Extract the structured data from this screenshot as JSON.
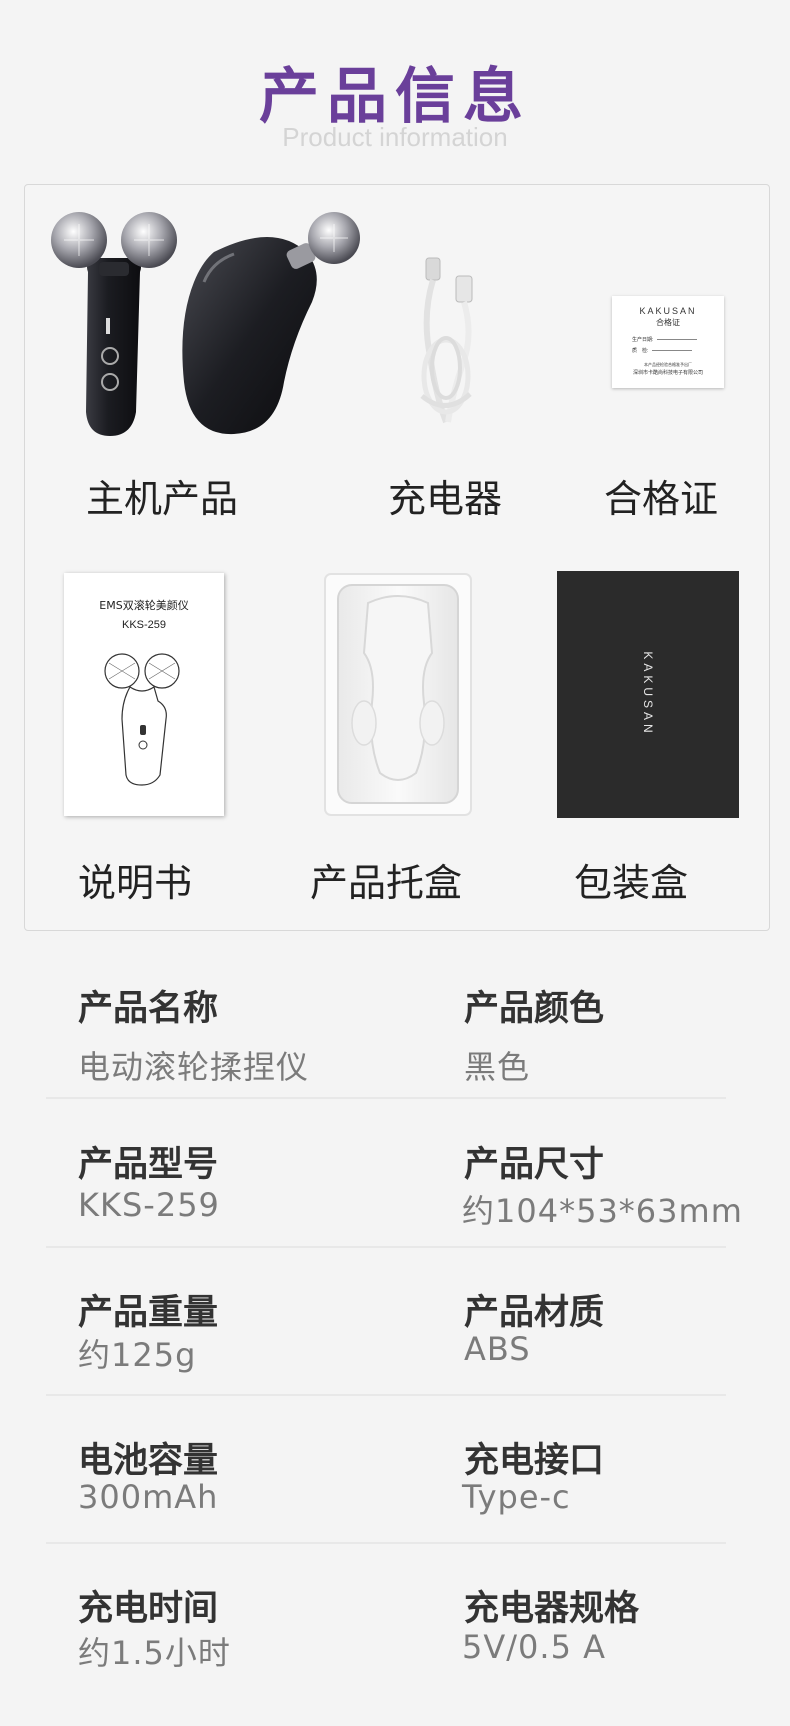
{
  "header": {
    "title": "产品信息",
    "subtitle": "Product information"
  },
  "package": {
    "items": [
      {
        "label": "主机产品"
      },
      {
        "label": "充电器"
      },
      {
        "label": "合格证"
      },
      {
        "label": "说明书"
      },
      {
        "label": "产品托盒"
      },
      {
        "label": "包装盒"
      }
    ],
    "certificate": {
      "brand": "KAKUSAN",
      "title": "合格证",
      "date_label": "生产日期:",
      "inspector_label": "质　检:",
      "footer_line1": "本产品经检验合格准予出厂",
      "footer_line2": "深圳市卡酷尚科技电子有限公司"
    },
    "manual": {
      "title": "EMS双滚轮美颜仪",
      "model": "KKS-259"
    },
    "box": {
      "brand": "KAKUSAN"
    }
  },
  "specs": [
    {
      "left": {
        "name": "产品名称",
        "value": "电动滚轮揉捏仪"
      },
      "right": {
        "name": "产品颜色",
        "value": "黑色"
      }
    },
    {
      "left": {
        "name": "产品型号",
        "value": "KKS-259"
      },
      "right": {
        "name": "产品尺寸",
        "value": "约104*53*63mm"
      }
    },
    {
      "left": {
        "name": "产品重量",
        "value": "约125g"
      },
      "right": {
        "name": "产品材质",
        "value": "ABS"
      }
    },
    {
      "left": {
        "name": "电池容量",
        "value": "300mAh"
      },
      "right": {
        "name": "充电接口",
        "value": "Type-c"
      }
    },
    {
      "left": {
        "name": "充电时间",
        "value": "约1.5小时"
      },
      "right": {
        "name": "充电器规格",
        "value": "5V/0.5 A"
      }
    }
  ],
  "colors": {
    "title": "#6a3f9a",
    "subtitle": "#d4d4d4",
    "device": "#1e1f24",
    "box": "#2b2b2b"
  }
}
